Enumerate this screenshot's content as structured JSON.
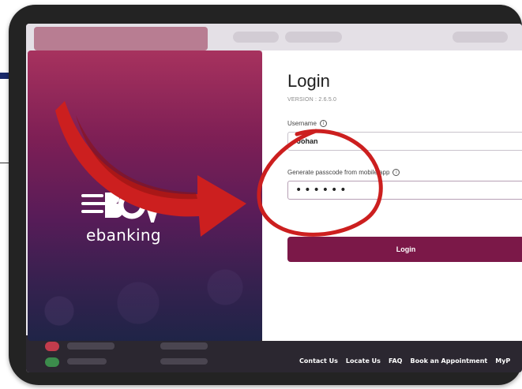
{
  "brand": {
    "logo_text": "ebanking",
    "logo_lettering": "BOV"
  },
  "login": {
    "title": "Login",
    "version": "VERSION : 2.6.5.0",
    "username_label": "Username",
    "username_value": "Johan",
    "passcode_label": "Generate passcode from mobile app",
    "passcode_value": "••••••",
    "button_label": "Login"
  },
  "footer": {
    "links": [
      "Contact Us",
      "Locate Us",
      "FAQ",
      "Book an Appointment",
      "MyP"
    ]
  },
  "colors": {
    "accent": "#7b1848",
    "annotation": "#cc1f1f",
    "panel_top": "#a7325e",
    "panel_bottom": "#1f2447"
  },
  "icons": [
    "info-icon",
    "arrow-annotation-icon",
    "highlight-circle-icon"
  ]
}
